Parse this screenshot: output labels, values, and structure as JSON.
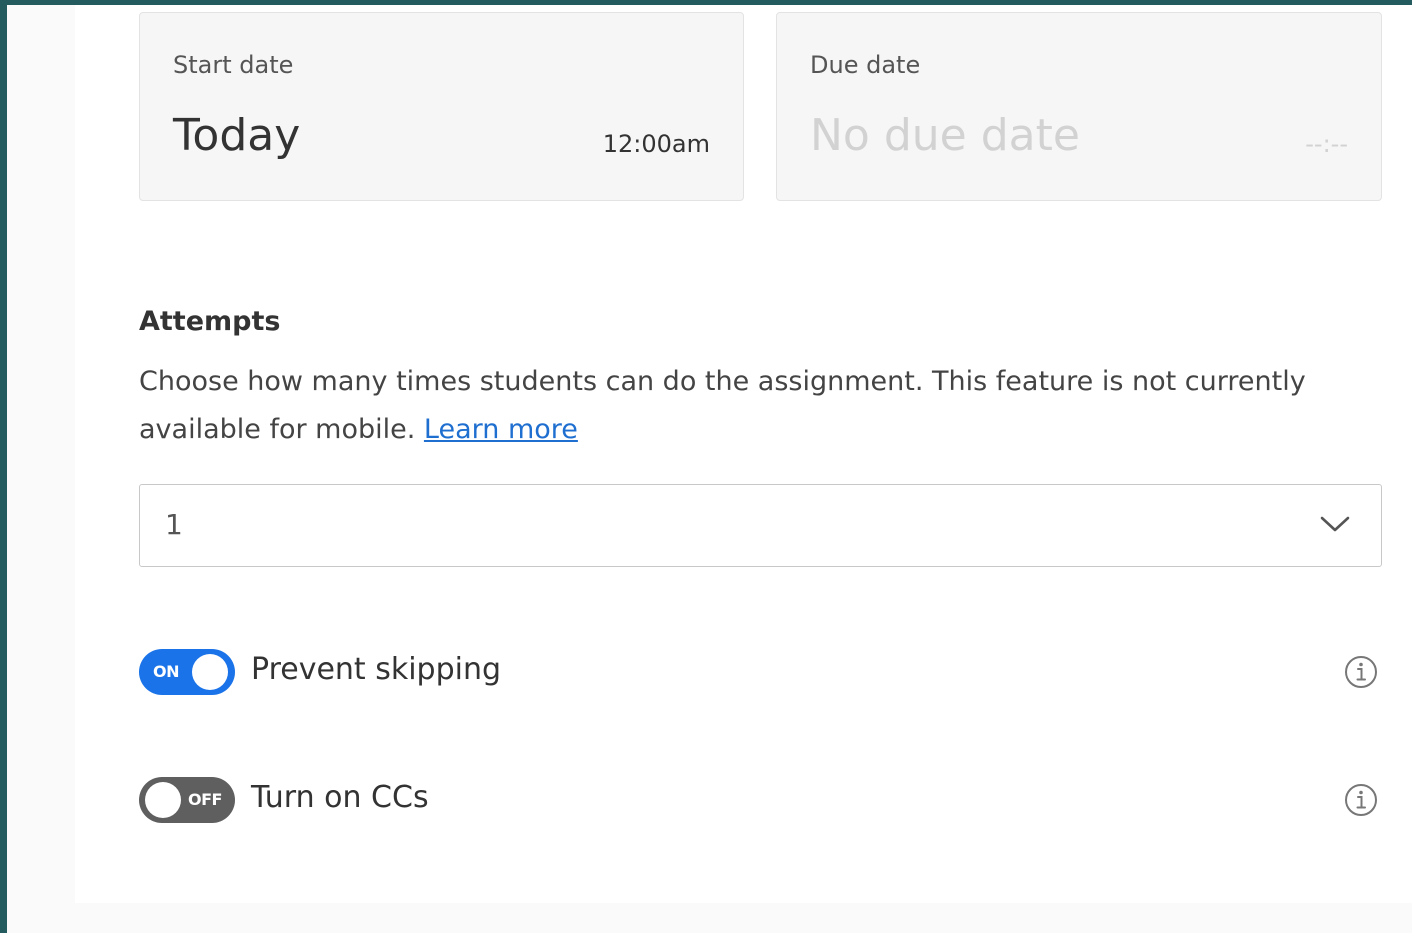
{
  "schedule": {
    "start": {
      "label": "Start date",
      "value": "Today",
      "time": "12:00am"
    },
    "due": {
      "label": "Due date",
      "value": "No due date",
      "time": "--:--"
    }
  },
  "attempts": {
    "title": "Attempts",
    "description": "Choose how many times students can do the assignment. This feature is not currently available for mobile.",
    "learn_more": "Learn more",
    "selected": "1"
  },
  "toggles": [
    {
      "label": "Prevent skipping",
      "state_text": "ON",
      "on": true
    },
    {
      "label": "Turn on CCs",
      "state_text": "OFF",
      "on": false
    }
  ],
  "colors": {
    "accent": "#1a73e8",
    "toggle_off": "#5f5f5f",
    "frame": "#245b5f",
    "link": "#1f6fd0"
  },
  "icons": {
    "select": "chevron-down-icon",
    "info": "info-icon"
  }
}
